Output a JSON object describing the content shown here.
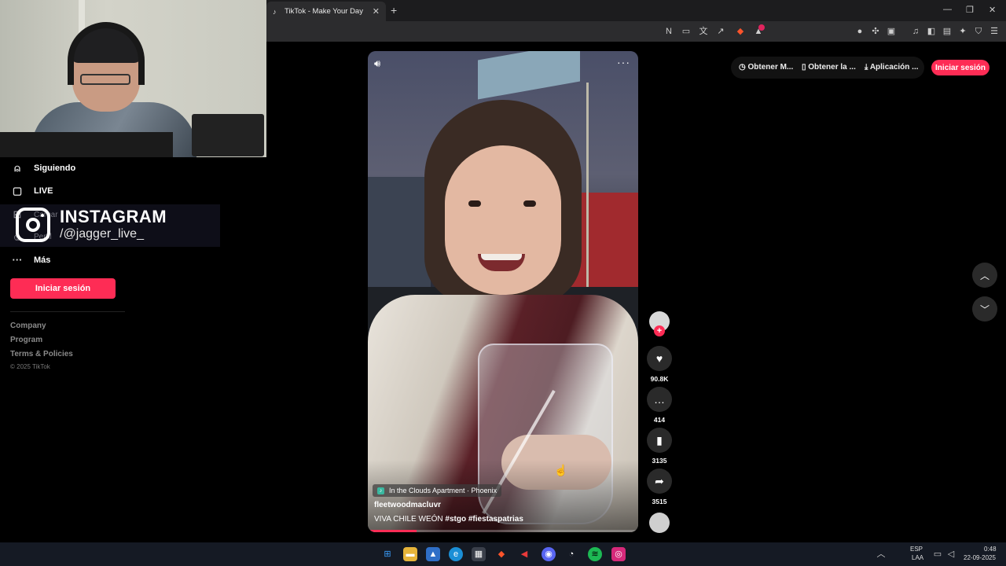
{
  "browser": {
    "tab_title": "TikTok - Make Your Day",
    "new_tab_glyph": "+",
    "close_glyph": "✕",
    "window_controls": [
      "—",
      "❐",
      "✕"
    ]
  },
  "overlay": {
    "title": "INSTAGRAM",
    "handle": "/@jagger_live_"
  },
  "sidebar": {
    "items": [
      {
        "label": "Siguiendo",
        "icon": "person-follow-icon"
      },
      {
        "label": "LIVE",
        "icon": "live-tv-icon"
      },
      {
        "label": "Cargar",
        "icon": "upload-icon"
      },
      {
        "label": "Perfil",
        "icon": "profile-icon"
      },
      {
        "label": "Más",
        "icon": "more-dots-icon"
      }
    ],
    "login_label": "Iniciar sesión",
    "footer_links": [
      "Company",
      "Program",
      "Terms & Policies"
    ],
    "copyright": "© 2025 TikTok"
  },
  "video": {
    "music": "In the Clouds Apartment · Phoenix",
    "username": "fleetwoodmacluvr",
    "caption_text": "VIVA CHILE WEÓN",
    "hashtags": [
      "#stgo",
      "#fiestaspatrias"
    ],
    "progress": 0.18
  },
  "actions": {
    "likes": "90.8K",
    "comments": "414",
    "saves": "3135",
    "shares": "3515"
  },
  "topbar": {
    "link1": "Obtener M...",
    "link2": "Obtener la ...",
    "link3": "Aplicación ...",
    "login_label": "Iniciar sesión"
  },
  "taskbar": {
    "lang_line1": "ESP",
    "lang_line2": "LAA",
    "time": "0:48",
    "date": "22-09-2025"
  },
  "colors": {
    "accent": "#fe2c55",
    "background": "#000000"
  }
}
